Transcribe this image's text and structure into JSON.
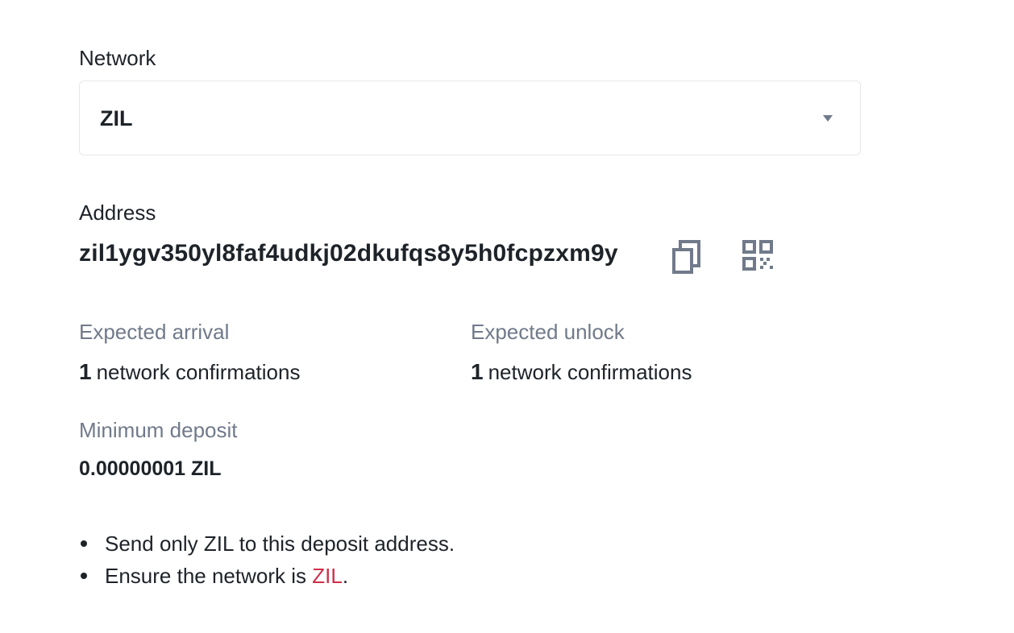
{
  "network": {
    "label": "Network",
    "selected": "ZIL"
  },
  "address": {
    "label": "Address",
    "value": "zil1ygv350yl8faf4udkj02dkufqs8y5h0fcpzxm9y",
    "copy_icon": "copy-icon",
    "qr_icon": "qr-code-icon"
  },
  "arrival": {
    "label": "Expected arrival",
    "count": "1",
    "text": "network confirmations"
  },
  "unlock": {
    "label": "Expected unlock",
    "count": "1",
    "text": "network confirmations"
  },
  "minimum": {
    "label": "Minimum deposit",
    "value": "0.00000001 ZIL"
  },
  "notes": {
    "note1": "Send only ZIL to this deposit address.",
    "note2_prefix": "Ensure the network is ",
    "note2_highlight": "ZIL",
    "note2_suffix": "."
  },
  "colors": {
    "text_primary": "#1e2329",
    "text_secondary": "#707a8a",
    "border": "#e6e8ea",
    "accent_red": "#cf304a"
  }
}
